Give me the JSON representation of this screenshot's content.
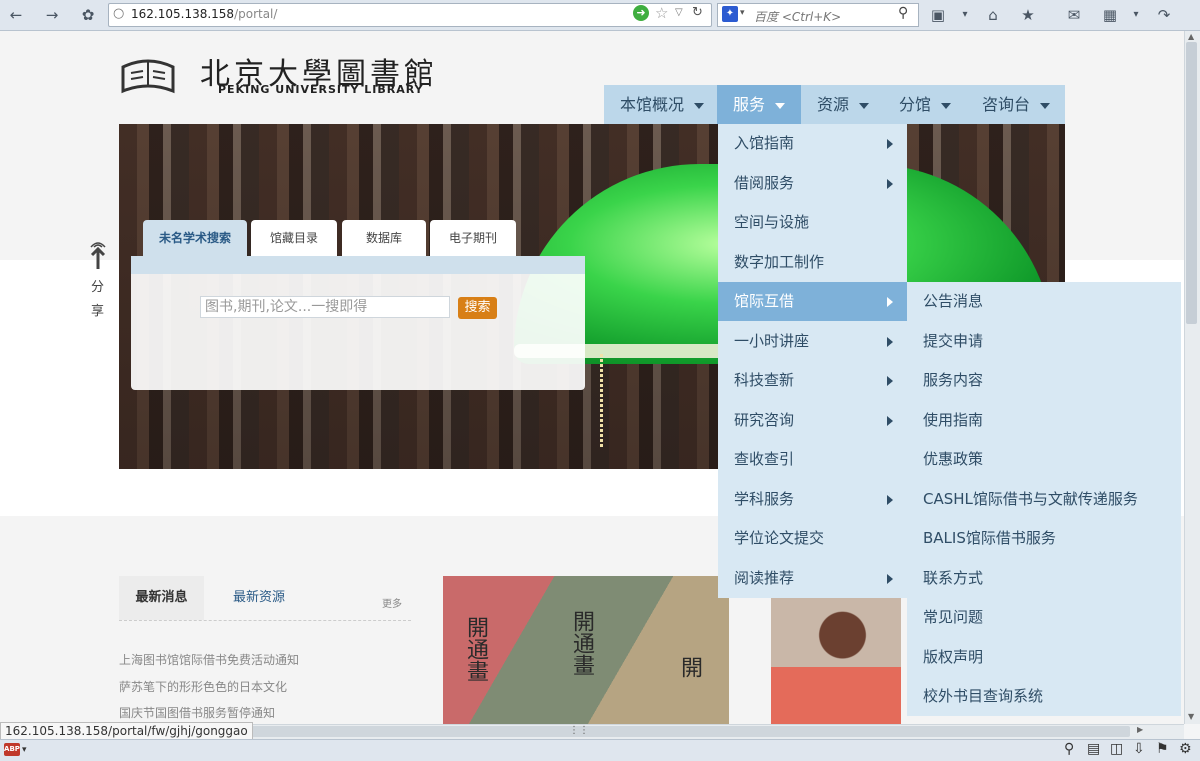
{
  "browser": {
    "url_host": "162.105.138.158",
    "url_path": "/portal/",
    "search_placeholder": "百度 <Ctrl+K>",
    "status_url": "162.105.138.158/portal/fw/gjhj/gonggao",
    "abp_label": "ABP"
  },
  "site": {
    "logo_title": "北京大學圖書館",
    "logo_subtitle": "PEKING UNIVERSITY LIBRARY",
    "share_label": "分享"
  },
  "nav": [
    {
      "label": "本馆概况"
    },
    {
      "label": "服务"
    },
    {
      "label": "资源"
    },
    {
      "label": "分馆"
    },
    {
      "label": "咨询台"
    }
  ],
  "search": {
    "tabs": [
      "未名学术搜索",
      "馆藏目录",
      "数据库",
      "电子期刊"
    ],
    "placeholder": "图书,期刊,论文...一搜即得",
    "button": "搜索"
  },
  "services_menu": [
    {
      "label": "入馆指南",
      "submenu": true
    },
    {
      "label": "借阅服务",
      "submenu": true
    },
    {
      "label": "空间与设施",
      "submenu": false
    },
    {
      "label": "数字加工制作",
      "submenu": false
    },
    {
      "label": "馆际互借",
      "submenu": true
    },
    {
      "label": "一小时讲座",
      "submenu": true
    },
    {
      "label": "科技查新",
      "submenu": true
    },
    {
      "label": "研究咨询",
      "submenu": true
    },
    {
      "label": "查收查引",
      "submenu": false
    },
    {
      "label": "学科服务",
      "submenu": true
    },
    {
      "label": "学位论文提交",
      "submenu": false
    },
    {
      "label": "阅读推荐",
      "submenu": true
    }
  ],
  "ill_submenu": [
    "公告消息",
    "提交申请",
    "服务内容",
    "使用指南",
    "优惠政策",
    "CASHL馆际借书与文献传递服务",
    "BALIS馆际借书服务",
    "联系方式",
    "常见问题",
    "版权声明",
    "校外书目查询系统"
  ],
  "news": {
    "tab_latest": "最新消息",
    "tab_resources": "最新资源",
    "more": "更多",
    "items": [
      "上海图书馆馆际借书免费活动通知",
      "萨苏笔下的形形色色的日本文化",
      "国庆节国图借书服务暂停通知"
    ]
  },
  "book_chars": [
    "開通畫",
    "開通畫",
    "開"
  ],
  "colors": {
    "nav_bg": "#bcd7ea",
    "nav_active": "#7eb1d9",
    "menu_bg": "#d8e8f3",
    "search_button": "#d87f16",
    "link": "#2a5a86"
  }
}
